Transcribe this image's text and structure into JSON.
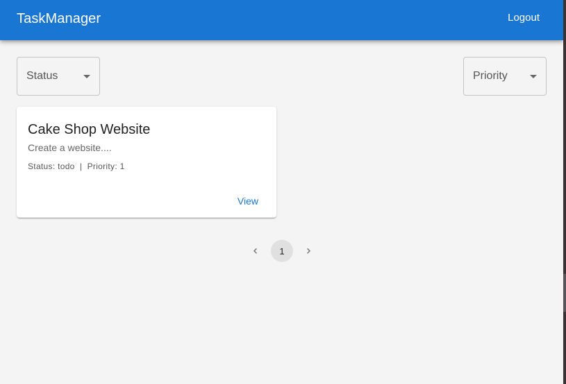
{
  "appbar": {
    "brand": "TaskManager",
    "logout_label": "Logout",
    "color": "#1976d2"
  },
  "filters": {
    "status_label": "Status",
    "priority_label": "Priority"
  },
  "tasks": [
    {
      "title": "Cake Shop Website",
      "description": "Create a website....",
      "meta": "Status: todo  |  Priority: 1",
      "view_label": "View"
    }
  ],
  "pagination": {
    "prev_icon": "chevron-left-icon",
    "pages": [
      "1"
    ],
    "current": "1",
    "next_icon": "chevron-right-icon"
  }
}
